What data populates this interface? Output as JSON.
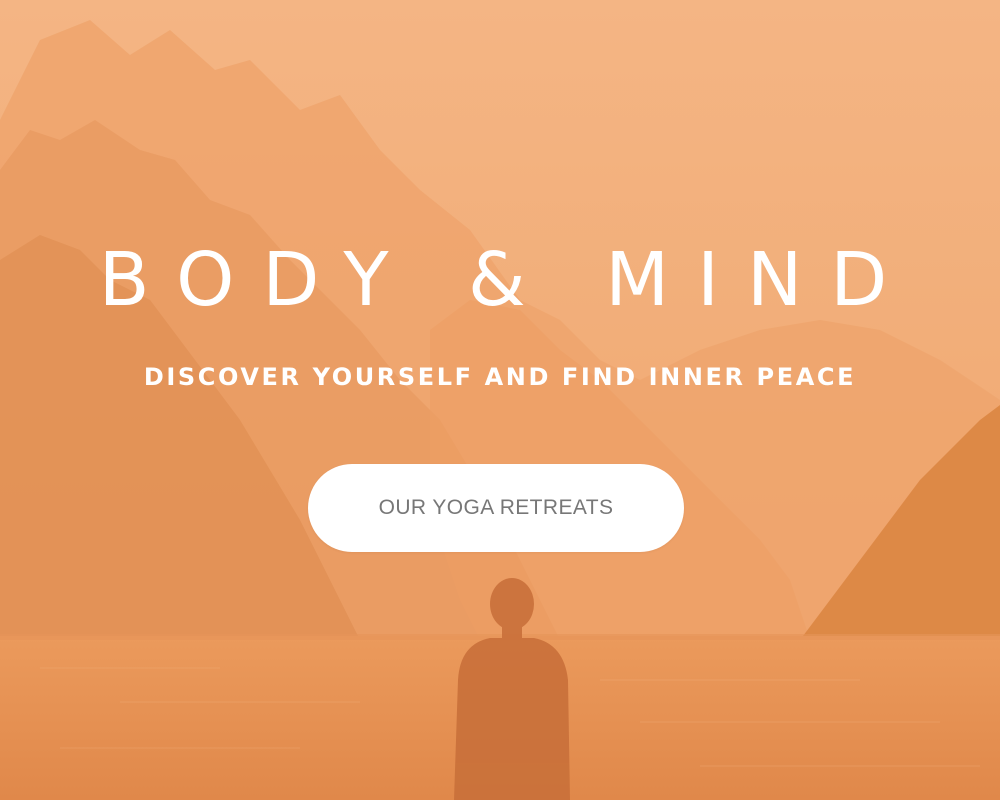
{
  "hero": {
    "title": "BODY & MIND",
    "subtitle": "DISCOVER YOURSELF AND FIND INNER PEACE",
    "cta_label": "OUR YOGA RETREATS",
    "background_image": "mountain-lake-meditation-photo",
    "overlay_color": "#f0a56c"
  },
  "colors": {
    "title_text": "#ffffff",
    "button_bg": "#ffffff",
    "button_text": "#777777"
  }
}
